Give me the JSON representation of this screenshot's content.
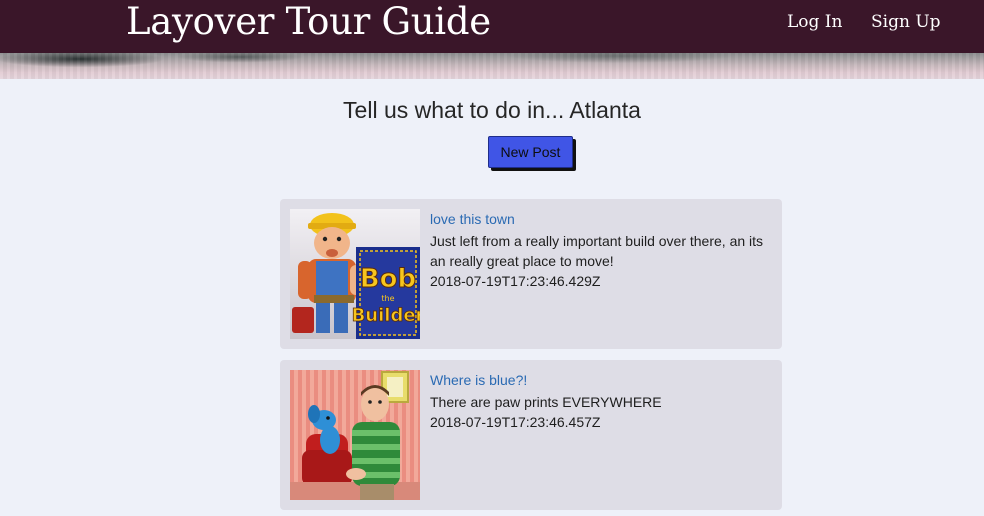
{
  "header": {
    "brand": "Layover Tour Guide",
    "nav": {
      "login": "Log In",
      "signup": "Sign Up"
    }
  },
  "main": {
    "headline": "Tell us what to do in... Atlanta",
    "new_post_label": "New Post"
  },
  "posts": [
    {
      "title": "love this town",
      "body": "Just left from a really important build over there, an its an really great place to move!",
      "date": "2018-07-19T17:23:46.429Z",
      "thumb_text_line1": "Bob",
      "thumb_text_line2": "the",
      "thumb_text_line3": "Builder"
    },
    {
      "title": "Where is blue?!",
      "body": "There are paw prints EVERYWHERE",
      "date": "2018-07-19T17:23:46.457Z"
    }
  ],
  "colors": {
    "header_bg": "#3a1629",
    "page_bg": "#eef1f9",
    "card_bg": "#dedde6",
    "link": "#2a6ab3",
    "button_bg": "#4055e6"
  }
}
